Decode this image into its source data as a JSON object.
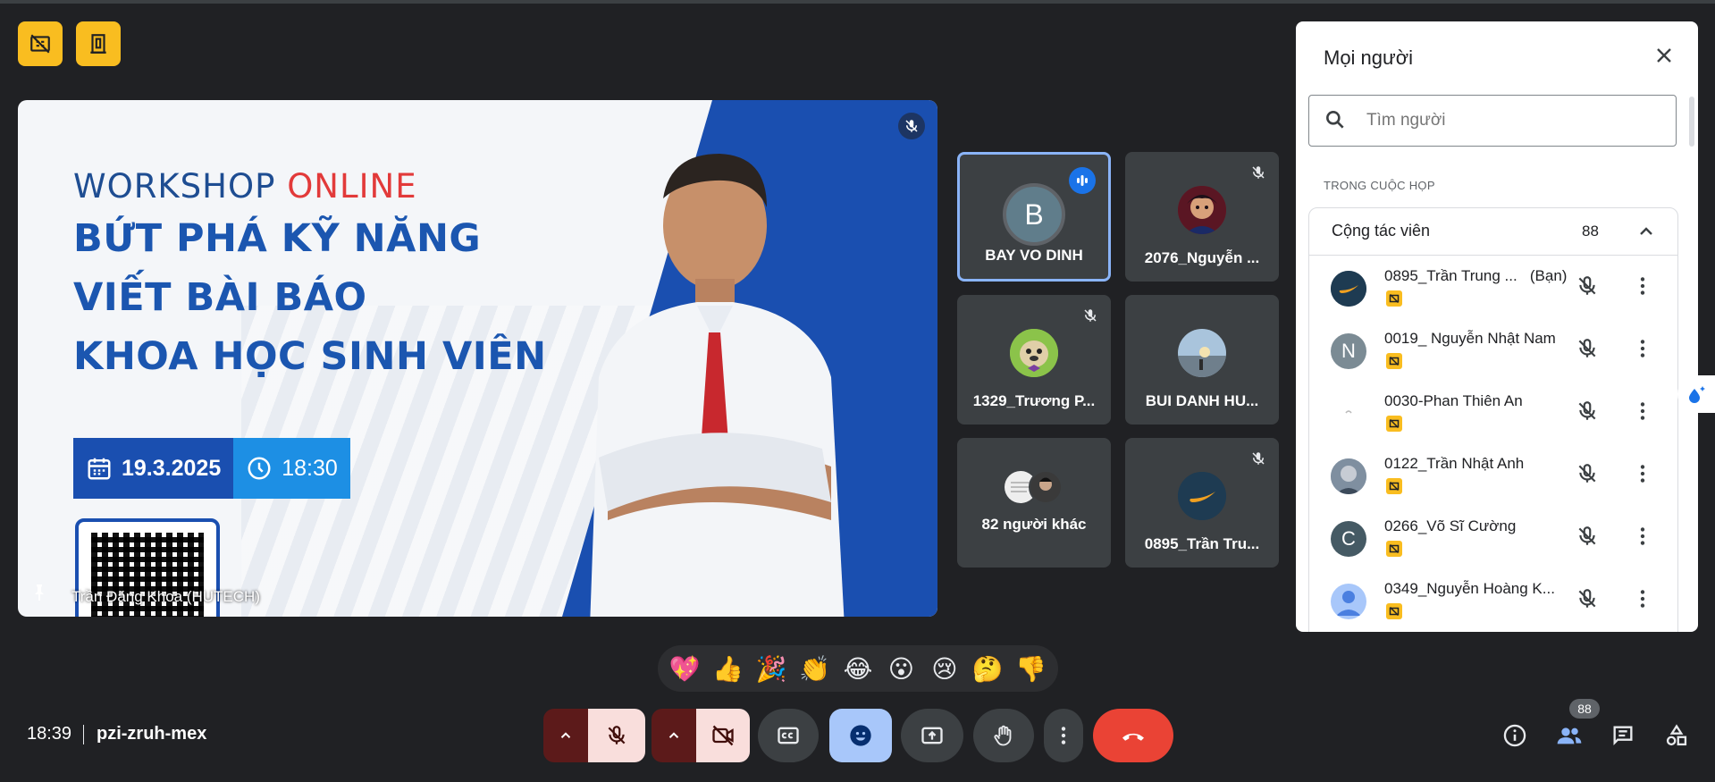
{
  "top_badges": [
    {
      "icon": "no-video-grid-icon"
    },
    {
      "icon": "door-icon"
    }
  ],
  "main_tile": {
    "slide": {
      "line1_a": "WORKSHOP ",
      "line1_b": "ONLINE",
      "line2": "BỨT PHÁ KỸ NĂNG",
      "line3": "VIẾT BÀI BÁO",
      "line4": "KHOA HỌC SINH VIÊN",
      "date": "19.3.2025",
      "time": "18:30"
    },
    "speaker": "Trần Đăng Khoa (HUTECH)"
  },
  "tiles": [
    {
      "name": "BAY VO DINH",
      "initial": "B"
    },
    {
      "name": "2076_Nguyễn ..."
    },
    {
      "name": "1329_Trương P..."
    },
    {
      "name": "BUI DANH HU..."
    },
    {
      "name": "82 người khác"
    },
    {
      "name": "0895_Trần Tru..."
    }
  ],
  "panel": {
    "title": "Mọi người",
    "search_placeholder": "Tìm người",
    "section": "TRONG CUỘC HỌP",
    "group_label": "Cộng tác viên",
    "group_count": "88",
    "people": [
      {
        "name": "0895_Trần Trung ...",
        "you": "(Bạn)"
      },
      {
        "name": "0019_ Nguyễn Nhật Nam",
        "initial": "N"
      },
      {
        "name": "0030-Phan Thiên An"
      },
      {
        "name": "0122_Trần Nhật Anh"
      },
      {
        "name": "0266_Võ Sĩ Cường",
        "initial": "C"
      },
      {
        "name": "0349_Nguyễn Hoàng K..."
      }
    ]
  },
  "reactions": [
    "💖",
    "👍",
    "🎉",
    "👏",
    "😂",
    "😮",
    "😢",
    "🤔",
    "👎"
  ],
  "bottom": {
    "time": "18:39",
    "meeting_code": "pzi-zruh-mex",
    "people_count": "88"
  },
  "colors": {
    "accent": "#8ab4f8",
    "badge": "#f9bd20",
    "end_call": "#ea4335",
    "panel": "#ffffff"
  }
}
